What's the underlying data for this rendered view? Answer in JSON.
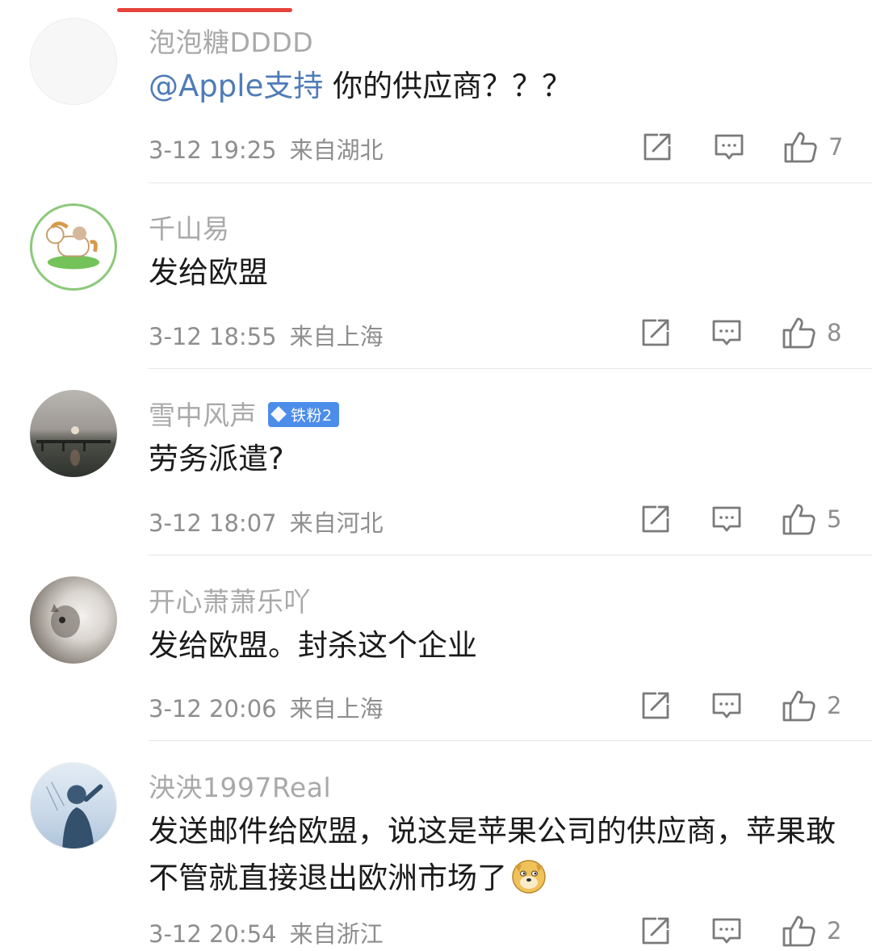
{
  "comments": [
    {
      "username": "泡泡糖DDDD",
      "mention": "@Apple支持",
      "text": " 你的供应商？？？",
      "time": "3-12 19:25",
      "location": "来自湖北",
      "likes": "7"
    },
    {
      "username": "千山易",
      "text": "发给欧盟",
      "time": "3-12 18:55",
      "location": "来自上海",
      "likes": "8"
    },
    {
      "username": "雪中风声",
      "badge": "铁粉2",
      "text": "劳务派遣?",
      "time": "3-12 18:07",
      "location": "来自河北",
      "likes": "5"
    },
    {
      "username": "开心萧萧乐吖",
      "text": "发给欧盟。封杀这个企业",
      "time": "3-12 20:06",
      "location": "来自上海",
      "likes": "2"
    },
    {
      "username": "泱泱1997Real",
      "text": "发送邮件给欧盟，说这是苹果公司的供应商，苹果敢不管就直接退出欧洲市场了",
      "emoji": "doge-emoji",
      "time": "3-12 20:54",
      "location": "来自浙江",
      "likes": "2"
    }
  ],
  "icons": {
    "share": "share-icon",
    "reply": "comment-icon",
    "like": "thumbs-up-icon"
  },
  "colors": {
    "accent_bar": "#e8433b",
    "mention": "#4f7cb7",
    "badge": "#4c8dea",
    "username": "#a9a9a9",
    "meta": "#8e8e8e"
  }
}
